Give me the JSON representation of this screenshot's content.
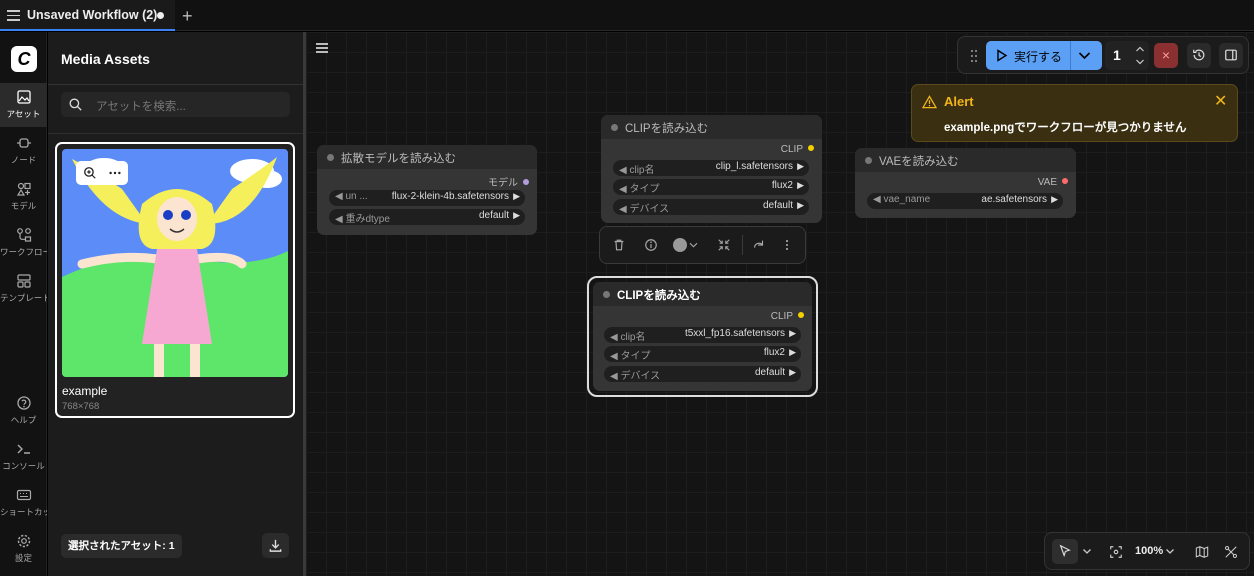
{
  "tab": {
    "title": "Unsaved Workflow (2)",
    "add": "+"
  },
  "rail": {
    "logo": "C",
    "items": [
      {
        "label": "アセット"
      },
      {
        "label": "ノード"
      },
      {
        "label": "モデル"
      },
      {
        "label": "ワークフロー"
      },
      {
        "label": "テンプレート"
      },
      {
        "label": "ヘルプ"
      },
      {
        "label": "コンソール"
      },
      {
        "label": "ショートカット"
      },
      {
        "label": "設定"
      }
    ]
  },
  "panel": {
    "title": "Media Assets",
    "search_placeholder": "アセットを検索...",
    "asset": {
      "name": "example",
      "dims": "768×768"
    },
    "selected_label": "選択されたアセット: 1"
  },
  "nodes": {
    "diffusion": {
      "title": "拡散モデルを読み込む",
      "output": "モデル",
      "w1_label": "un ...",
      "w1_value": "flux-2-klein-4b.safetensors",
      "w2_label": "重みdtype",
      "w2_value": "default"
    },
    "clip1": {
      "title": "CLIPを読み込む",
      "output": "CLIP",
      "w1_label": "clip名",
      "w1_value": "clip_l.safetensors",
      "w2_label": "タイプ",
      "w2_value": "flux2",
      "w3_label": "デバイス",
      "w3_value": "default"
    },
    "clip2": {
      "title": "CLIPを読み込む",
      "output": "CLIP",
      "w1_label": "clip名",
      "w1_value": "t5xxl_fp16.safetensors",
      "w2_label": "タイプ",
      "w2_value": "flux2",
      "w3_label": "デバイス",
      "w3_value": "default"
    },
    "vae": {
      "title": "VAEを読み込む",
      "output": "VAE",
      "w1_label": "vae_name",
      "w1_value": "ae.safetensors"
    }
  },
  "run": {
    "label": "実行する",
    "count": "1"
  },
  "alert": {
    "title": "Alert",
    "message": "example.pngでワークフローが見つかりません"
  },
  "zoom": {
    "level": "100%"
  },
  "colors": {
    "accent": "#5ba0f5",
    "alert": "#f2b51c",
    "clip_port": "#f5d000",
    "vae_port": "#ff6b6b",
    "model_port": "#b39ddb"
  }
}
